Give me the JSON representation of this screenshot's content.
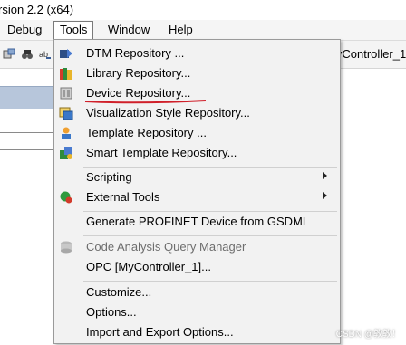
{
  "window": {
    "title_fragment": "rsion 2.2 (x64)"
  },
  "menubar": {
    "items": [
      {
        "label": "Debug"
      },
      {
        "label": "Tools"
      },
      {
        "label": "Window"
      },
      {
        "label": "Help"
      }
    ]
  },
  "toolbar": {
    "controller_text": "lyController_1"
  },
  "tools_menu": {
    "items": [
      {
        "label": "DTM Repository ...",
        "icon": "dtm-repository-icon"
      },
      {
        "label": "Library Repository...",
        "icon": "library-repository-icon"
      },
      {
        "label": "Device Repository...",
        "icon": "device-repository-icon",
        "highlighted_by_underline": true
      },
      {
        "label": "Visualization Style Repository...",
        "icon": "visualization-style-icon"
      },
      {
        "label": "Template Repository ...",
        "icon": "template-repository-icon"
      },
      {
        "label": "Smart Template Repository...",
        "icon": "smart-template-icon"
      },
      {
        "label": "Scripting",
        "submenu": true
      },
      {
        "label": "External Tools",
        "icon": "external-tools-icon",
        "submenu": true
      },
      {
        "label": "Generate PROFINET Device from GSDML"
      },
      {
        "label": "Code Analysis Query Manager",
        "icon": "code-analysis-icon",
        "disabled": true
      },
      {
        "label": "OPC [MyController_1]..."
      },
      {
        "label": "Customize..."
      },
      {
        "label": "Options..."
      },
      {
        "label": "Import and Export Options..."
      }
    ]
  },
  "annotation": {
    "underline_color": "#d0202a"
  },
  "watermark": "CSDN @敦敦！"
}
